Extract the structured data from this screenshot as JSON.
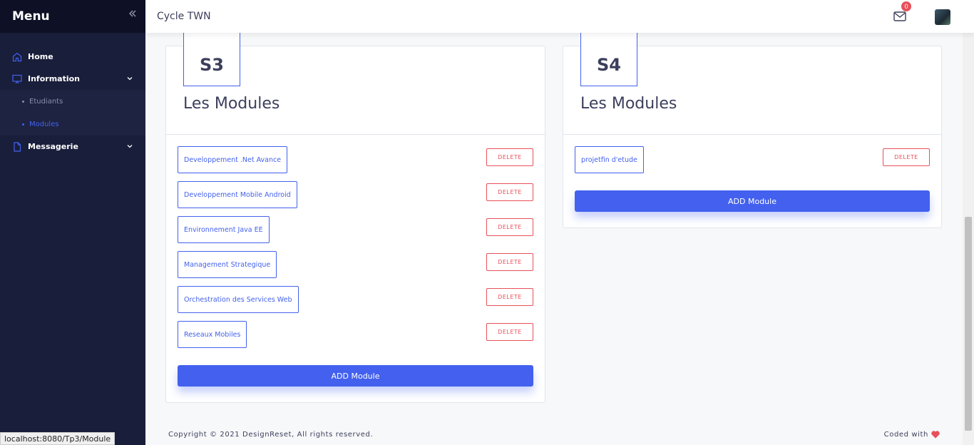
{
  "sidebar": {
    "title": "Menu",
    "items": [
      {
        "label": "Home"
      },
      {
        "label": "Information"
      },
      {
        "label": "Messagerie"
      }
    ],
    "submenu": [
      {
        "label": "Etudiants"
      },
      {
        "label": "Modules"
      }
    ]
  },
  "header": {
    "brand": "Cycle TWN",
    "mail_count": "0"
  },
  "cards": [
    {
      "semester": "S3",
      "title": "Les Modules",
      "modules": [
        "Developpement .Net Avance",
        "Developpement Mobile Android",
        "Environnement Java EE",
        "Management Strategique",
        "Orchestration des Services Web",
        "Reseaux Mobiles"
      ],
      "delete_label": "DELETE",
      "add_label": "ADD Module"
    },
    {
      "semester": "S4",
      "title": "Les Modules",
      "modules": [
        "projetfin d'etude"
      ],
      "delete_label": "DELETE",
      "add_label": "ADD Module"
    }
  ],
  "footer": {
    "copyright": "Copyright © 2021 DesignReset, All rights reserved.",
    "coded": "Coded with"
  },
  "status_bar": {
    "url": "localhost:8080/Tp3/Module"
  },
  "colors": {
    "accent": "#4361ee",
    "danger": "#e7515a",
    "sidebar": "#191e3a"
  }
}
